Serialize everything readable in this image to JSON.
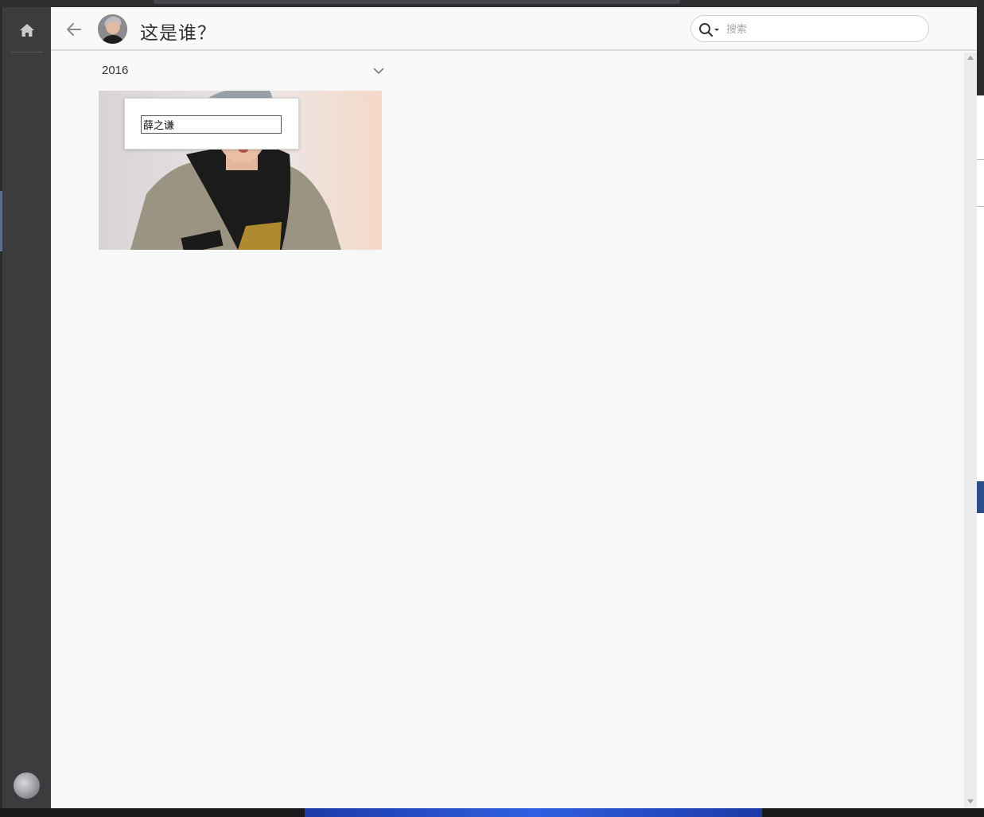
{
  "header": {
    "title": "这是谁？",
    "search_placeholder": "搜索"
  },
  "content": {
    "date_label": "2016",
    "name_input_value": "薛之谦"
  },
  "icons": {
    "home": "home-icon",
    "back": "back-arrow-icon",
    "search": "search-icon",
    "search_options": "caret-down-icon",
    "collapse": "chevron-down-icon"
  },
  "colors": {
    "sidebar": "#3c3b3e",
    "main_bg": "#f8f8f8",
    "title": "#333333"
  }
}
